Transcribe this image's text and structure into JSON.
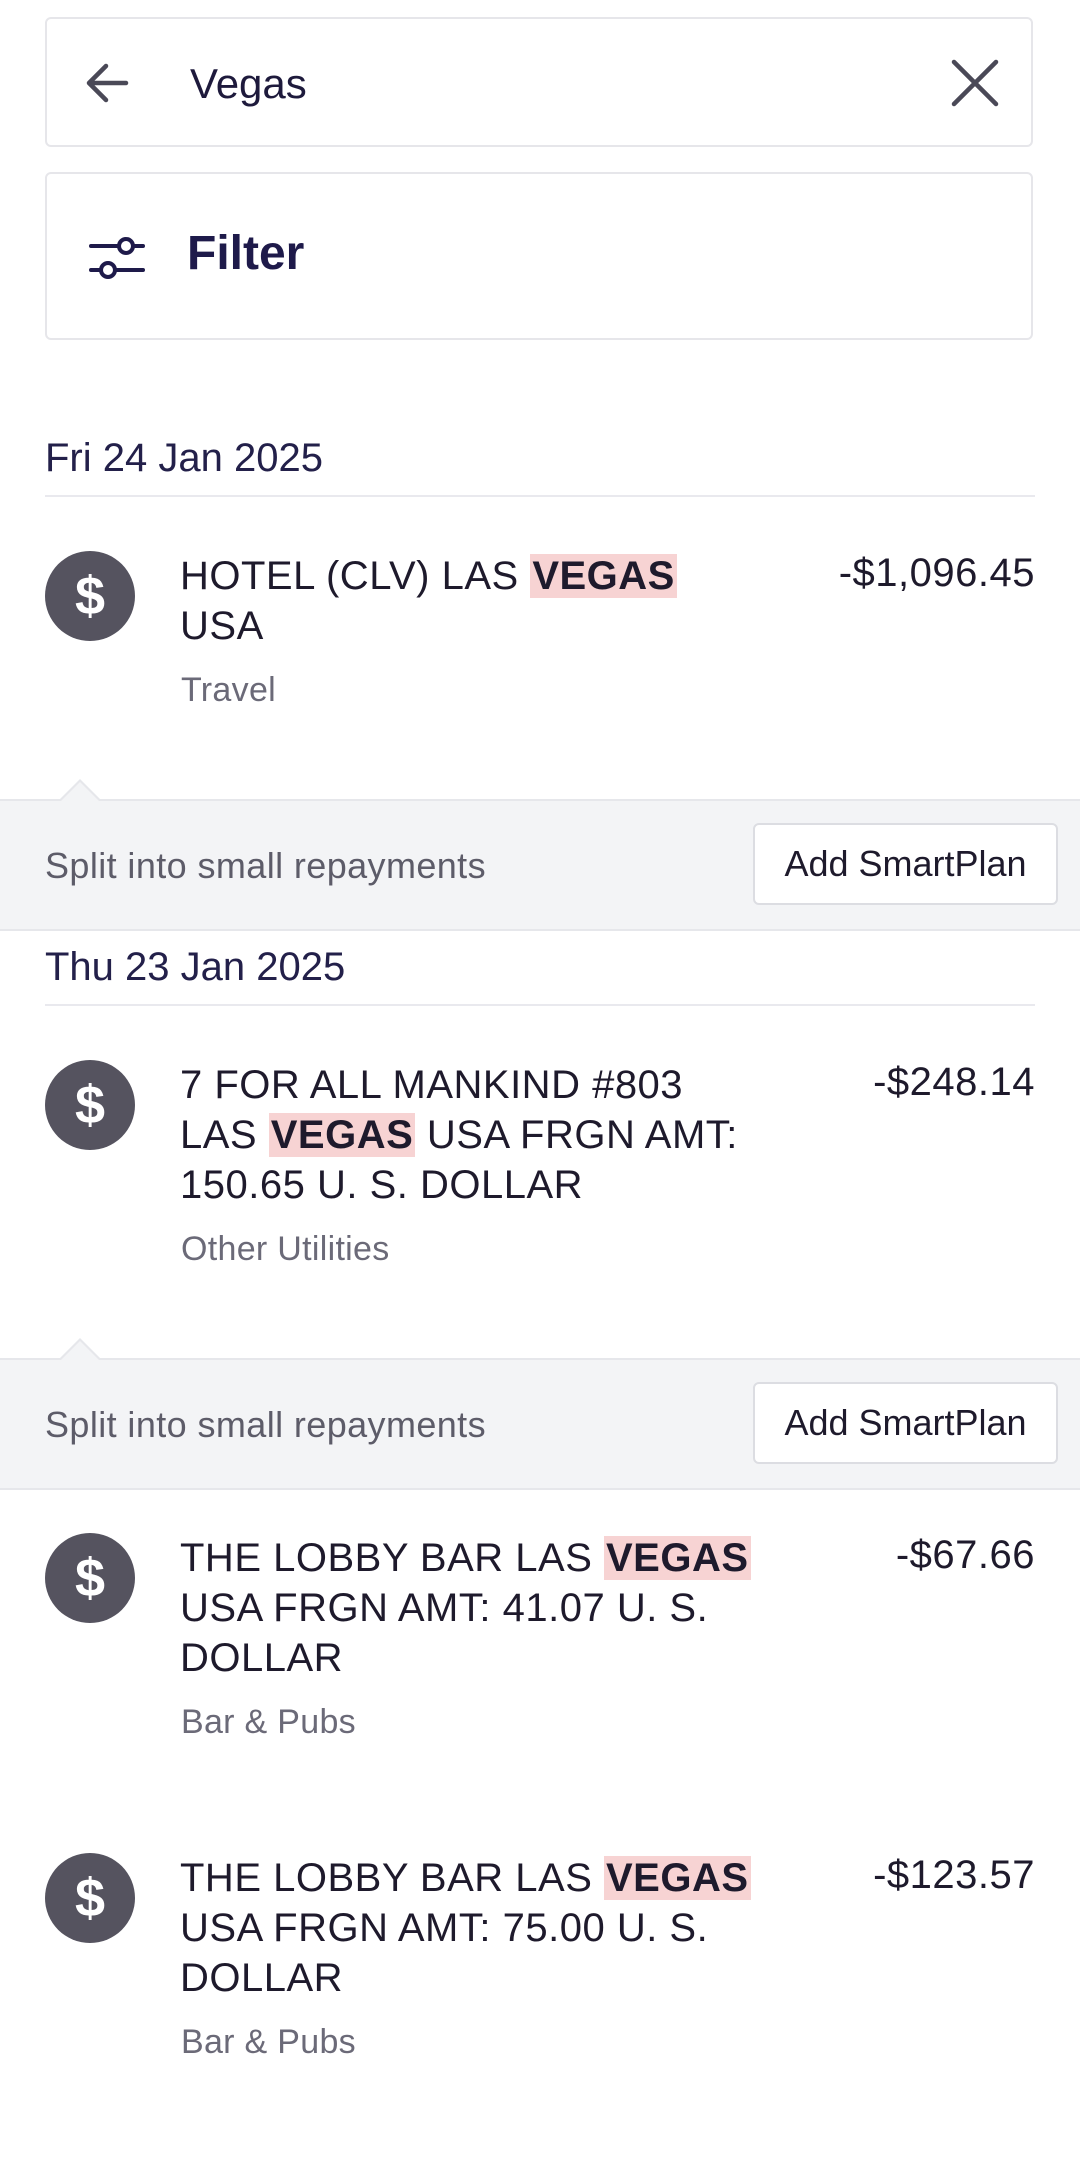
{
  "search": {
    "value": "Vegas"
  },
  "filter": {
    "label": "Filter"
  },
  "groups": [
    {
      "date": "Fri 24 Jan 2025",
      "transactions": [
        {
          "desc_before": "HOTEL (CLV) LAS ",
          "highlight": "VEGAS",
          "desc_after": " USA",
          "category": "Travel",
          "amount": "-$1,096.45"
        }
      ]
    },
    {
      "date": "Thu 23 Jan 2025",
      "transactions": [
        {
          "desc_before": "7 FOR ALL MANKIND #803 LAS ",
          "highlight": "VEGAS",
          "desc_after": " USA FRGN AMT: 150.65 U. S. DOLLAR",
          "category": "Other Utilities",
          "amount": "-$248.14"
        },
        {
          "desc_before": "THE LOBBY BAR LAS ",
          "highlight": "VEGAS",
          "desc_after": " USA FRGN AMT: 41.07 U. S. DOLLAR",
          "category": "Bar & Pubs",
          "amount": "-$67.66"
        },
        {
          "desc_before": "THE LOBBY BAR LAS ",
          "highlight": "VEGAS",
          "desc_after": " USA FRGN AMT: 75.00 U. S. DOLLAR",
          "category": "Bar & Pubs",
          "amount": "-$123.57"
        }
      ]
    }
  ],
  "smartplan": {
    "text": "Split into small repayments",
    "button": "Add SmartPlan"
  },
  "colors": {
    "highlight": "#f7d3d3",
    "avatar": "#55535f",
    "band": "#f3f4f6",
    "primary_text": "#1e1a3c"
  },
  "icons": {
    "back": "arrow-left-icon",
    "clear": "close-icon",
    "filter": "sliders-icon",
    "avatar": "dollar-icon"
  }
}
